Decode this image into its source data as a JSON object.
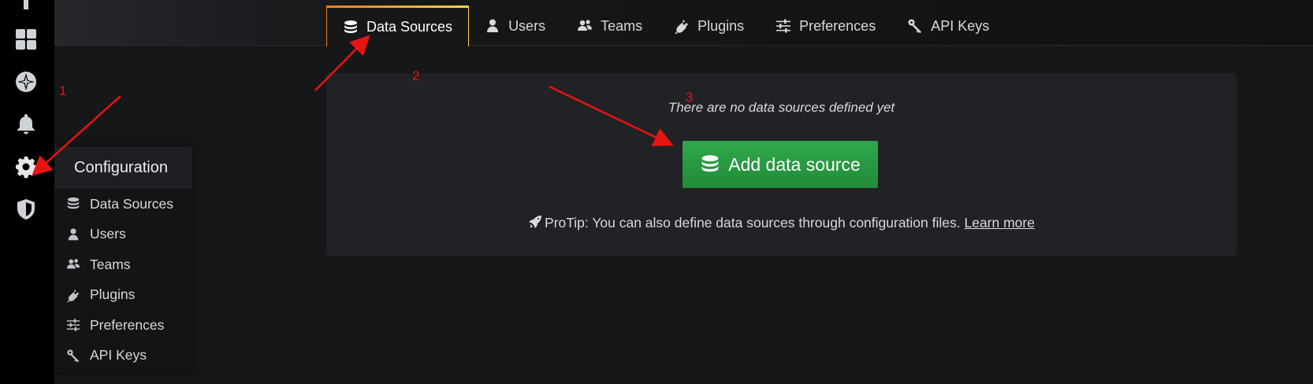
{
  "sidenav": {
    "items": [
      {
        "name": "dashboards",
        "icon": "grid-icon"
      },
      {
        "name": "explore",
        "icon": "compass-icon"
      },
      {
        "name": "alerting",
        "icon": "bell-icon"
      },
      {
        "name": "configuration",
        "icon": "gear-icon"
      },
      {
        "name": "server-admin",
        "icon": "shield-icon"
      }
    ]
  },
  "tabs": [
    {
      "label": "Data Sources",
      "icon": "database-icon",
      "active": true
    },
    {
      "label": "Users",
      "icon": "user-icon",
      "active": false
    },
    {
      "label": "Teams",
      "icon": "users-icon",
      "active": false
    },
    {
      "label": "Plugins",
      "icon": "plug-icon",
      "active": false
    },
    {
      "label": "Preferences",
      "icon": "sliders-icon",
      "active": false
    },
    {
      "label": "API Keys",
      "icon": "key-icon",
      "active": false
    }
  ],
  "empty_state": {
    "message": "There are no data sources defined yet",
    "button_label": "Add data source",
    "protip_text": "ProTip: You can also define data sources through configuration files. ",
    "learn_more": "Learn more"
  },
  "config_menu": {
    "title": "Configuration",
    "items": [
      {
        "label": "Data Sources",
        "icon": "database-icon"
      },
      {
        "label": "Users",
        "icon": "user-icon"
      },
      {
        "label": "Teams",
        "icon": "users-icon"
      },
      {
        "label": "Plugins",
        "icon": "plug-icon"
      },
      {
        "label": "Preferences",
        "icon": "sliders-icon"
      },
      {
        "label": "API Keys",
        "icon": "key-icon"
      }
    ]
  },
  "annotations": {
    "color": "#e81414",
    "labels": [
      "1",
      "2",
      "3"
    ]
  },
  "colors": {
    "background": "#161719",
    "panel": "#212226",
    "button_green": "#299c46",
    "tab_accent": "#eb7b18"
  }
}
